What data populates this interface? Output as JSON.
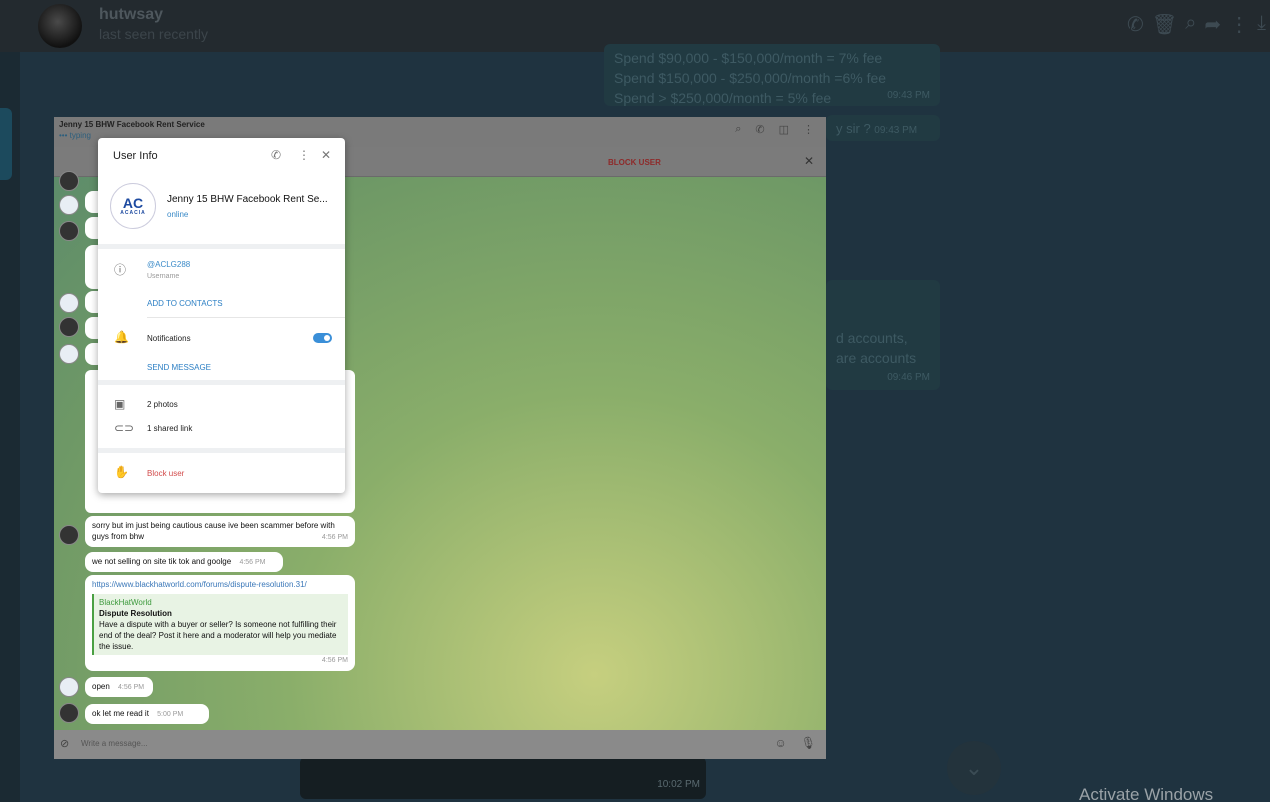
{
  "outer": {
    "contact_name": "hutwsay",
    "contact_status": "last seen recently",
    "bubble_lines": [
      "Spend $90,000 - $150,000/month = 7% fee",
      "Spend $150,000 - $250,000/month =6% fee",
      "Spend > $250,000/month = 5% fee"
    ],
    "bubble_time_1": "09:43 PM",
    "partial_sir": "y sir ?",
    "partial_sir_time": "09:43 PM",
    "partial_accounts_1": "d accounts,",
    "partial_accounts_2": "are accounts",
    "partial_accounts_time": "09:46 PM",
    "bottom_time": "10:02 PM",
    "watermark": "Activate Windows"
  },
  "telegram": {
    "chat_title": "Jenny 15 BHW Facebook Rent Service",
    "typing": "••• typing",
    "block_bar_label": "BLOCK USER",
    "messages": {
      "m1_text": "sorry but im just being cautious cause ive been scammer before with guys from bhw",
      "m1_time": "4:56 PM",
      "m2_text": "we not selling on site  tik tok and goolge",
      "m2_time": "4:56 PM",
      "m3_link": "https://www.blackhatworld.com/forums/dispute-resolution.31/",
      "m3_source": "BlackHatWorld",
      "m3_title": "Dispute Resolution",
      "m3_desc": "Have a dispute with a buyer or seller? Is someone not fulfilling their end of the deal? Post it here and a moderator will help you mediate the issue.",
      "m3_time": "4:56 PM",
      "m4_text": "open",
      "m4_time": "4:56 PM",
      "m5_text": "ok let me read it",
      "m5_time": "5:00 PM"
    },
    "input_placeholder": "Write a message..."
  },
  "modal": {
    "title": "User Info",
    "profile_name": "Jenny 15 BHW Facebook Rent Se...",
    "profile_status": "online",
    "avatar_logo_main": "AC",
    "avatar_logo_sub": "ACACIA",
    "username": "@ACLG288",
    "username_label": "Username",
    "add_to_contacts": "ADD TO CONTACTS",
    "notifications_label": "Notifications",
    "notifications_on": true,
    "send_message": "SEND MESSAGE",
    "photos": "2 photos",
    "shared_links": "1 shared link",
    "block_user": "Block user"
  },
  "colors": {
    "accent_blue": "#2c7fc4",
    "danger_red": "#d24b4b",
    "toggle_on": "#3a8fd8"
  }
}
